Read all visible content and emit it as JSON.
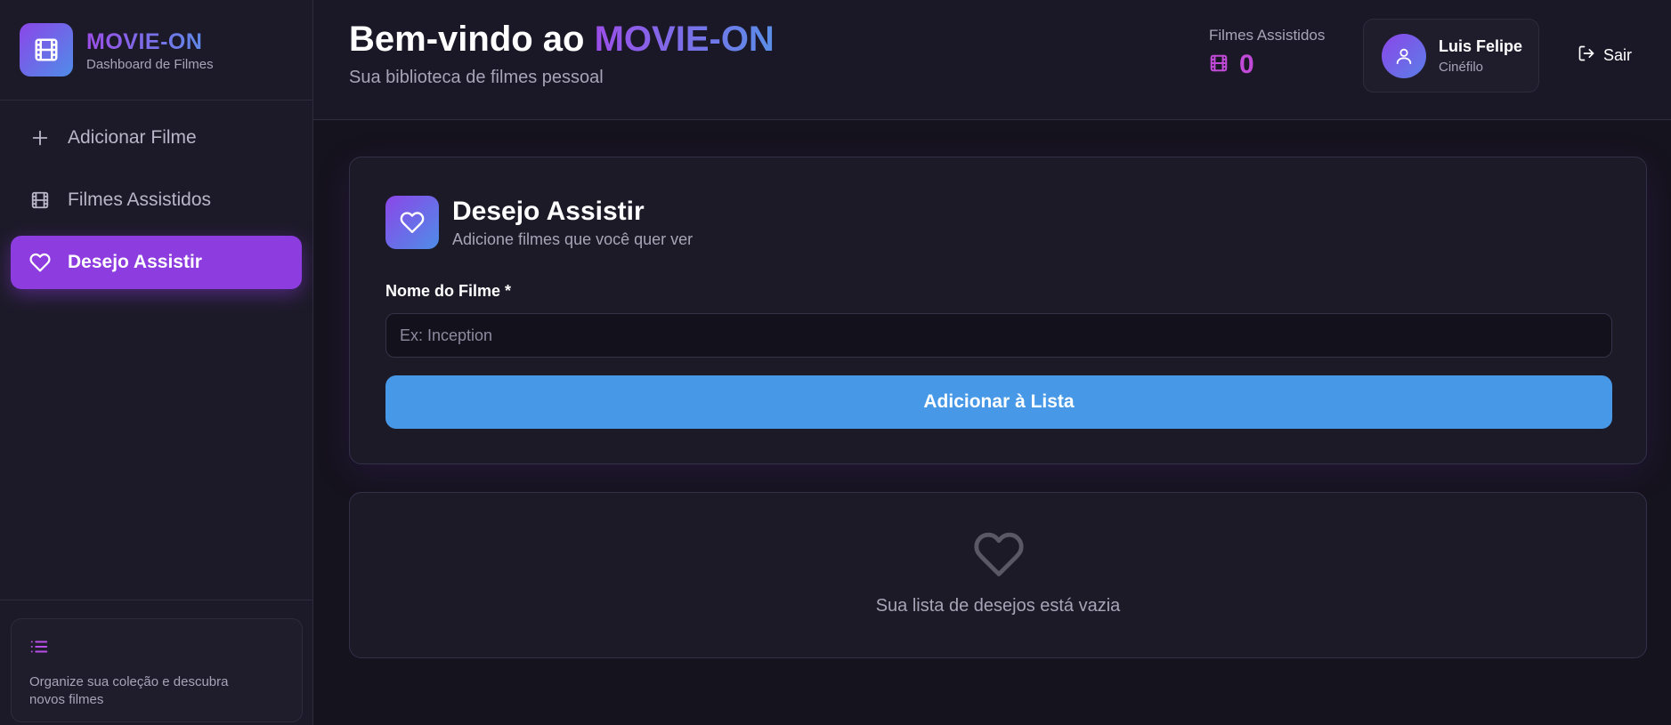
{
  "brand": {
    "title": "MOVIE-ON",
    "subtitle": "Dashboard de Filmes",
    "logo_icon": "film-icon"
  },
  "sidebar": {
    "items": [
      {
        "label": "Adicionar Filme",
        "icon": "plus-icon",
        "active": false
      },
      {
        "label": "Filmes Assistidos",
        "icon": "film-icon",
        "active": false
      },
      {
        "label": "Desejo Assistir",
        "icon": "heart-icon",
        "active": true
      }
    ],
    "tip": {
      "icon": "list-icon",
      "text": "Organize sua coleção e descubra novos filmes"
    }
  },
  "header": {
    "welcome_prefix": "Bem-vindo ao ",
    "welcome_brand": "MOVIE-ON",
    "subtitle": "Sua biblioteca de filmes pessoal",
    "stat_label": "Filmes Assistidos",
    "stat_value": "0",
    "user_name": "Luis Felipe",
    "user_role": "Cinéfilo",
    "logout_label": "Sair"
  },
  "wishlist_form": {
    "title": "Desejo Assistir",
    "subtitle": "Adicione filmes que você quer ver",
    "field_label": "Nome do Filme *",
    "field_value": "",
    "field_placeholder": "Ex: Inception",
    "submit_label": "Adicionar à Lista"
  },
  "wishlist_empty": {
    "icon": "heart-outline-icon",
    "text": "Sua lista de desejos está vazia"
  },
  "colors": {
    "accent_purple": "#8d3ce0",
    "accent_blue": "#4799e8",
    "stat_pink": "#c24ad8",
    "background": "#16141f"
  }
}
